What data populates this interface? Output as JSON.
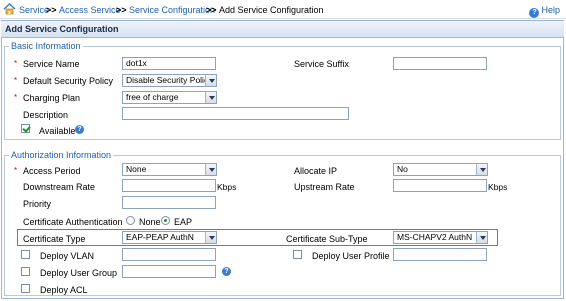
{
  "breadcrumb": {
    "items": [
      "Service",
      "Access Service",
      "Service Configuration"
    ],
    "current": "Add Service Configuration",
    "separator": ">>"
  },
  "help": {
    "label": "Help"
  },
  "panel": {
    "title": "Add Service Configuration"
  },
  "basic": {
    "legend": "Basic Information",
    "service_name": {
      "label": "Service Name",
      "value": "dot1x"
    },
    "service_suffix": {
      "label": "Service Suffix",
      "value": ""
    },
    "default_security_policy": {
      "label": "Default Security Policy",
      "value": "Disable Security Policy"
    },
    "charging_plan": {
      "label": "Charging Plan",
      "value": "free of charge"
    },
    "description": {
      "label": "Description",
      "value": ""
    },
    "available": {
      "label": "Available",
      "checked": true
    }
  },
  "auth": {
    "legend": "Authorization Information",
    "access_period": {
      "label": "Access Period",
      "value": "None"
    },
    "allocate_ip": {
      "label": "Allocate IP",
      "value": "No"
    },
    "downstream_rate": {
      "label": "Downstream Rate",
      "value": "",
      "unit": "Kbps"
    },
    "upstream_rate": {
      "label": "Upstream Rate",
      "value": "",
      "unit": "Kbps"
    },
    "priority": {
      "label": "Priority",
      "value": ""
    },
    "cert_auth": {
      "label": "Certificate Authentication",
      "options": [
        "None",
        "EAP"
      ],
      "selected": "EAP"
    },
    "cert_type": {
      "label": "Certificate Type",
      "value": "EAP-PEAP AuthN"
    },
    "cert_subtype": {
      "label": "Certificate Sub-Type",
      "value": "MS-CHAPV2 AuthN"
    },
    "deploy_vlan": {
      "label": "Deploy VLAN",
      "value": ""
    },
    "deploy_user_profile": {
      "label": "Deploy User Profile",
      "value": ""
    },
    "deploy_user_group": {
      "label": "Deploy User Group",
      "value": ""
    },
    "deploy_acl": {
      "label": "Deploy ACL"
    }
  },
  "required_marker": "*",
  "colors": {
    "link": "#1f5fb0",
    "highlight": "#e14b4b",
    "check": "#1a9a1a"
  }
}
